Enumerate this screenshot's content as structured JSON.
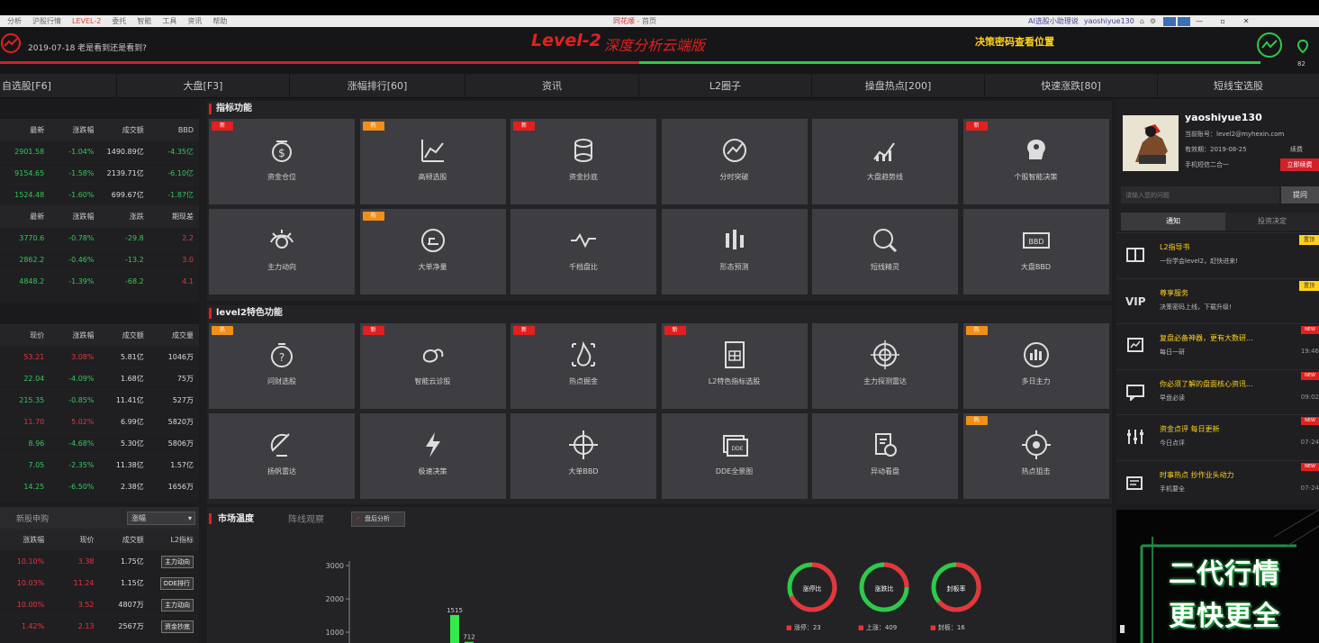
{
  "menubar": {
    "items": [
      "分析",
      "沪股行情",
      "LEVEL-2",
      "委托",
      "智能",
      "工具",
      "资讯",
      "帮助"
    ],
    "center_app": "同花顺",
    "center_rest": " - 首页",
    "right_text": "AI选股小助理说",
    "user": "yaoshiyue130"
  },
  "header": {
    "date_text": "2019-07-18 老是看到还是看到?",
    "title": "Level-2",
    "subtitle": "深度分析云端版",
    "notice": "决策密码查看位置",
    "count": "82"
  },
  "tabs": [
    {
      "label": "自选股[F6]"
    },
    {
      "label": "大盘[F3]"
    },
    {
      "label": "涨幅排行[60]"
    },
    {
      "label": "资讯"
    },
    {
      "label": "L2圈子"
    },
    {
      "label": "操盘热点[200]"
    },
    {
      "label": "快速涨跌[80]"
    },
    {
      "label": "短线宝选股"
    }
  ],
  "index_table": {
    "headers1": [
      "最新",
      "涨跌幅",
      "成交额",
      "BBD"
    ],
    "rows1": [
      [
        "2901.58",
        "-1.04%",
        "1490.89亿",
        "-4.35亿"
      ],
      [
        "9154.65",
        "-1.58%",
        "2139.71亿",
        "-6.10亿"
      ],
      [
        "1524.48",
        "-1.60%",
        "699.67亿",
        "-1.87亿"
      ]
    ],
    "headers2": [
      "最新",
      "涨跌幅",
      "涨跌",
      "期现差"
    ],
    "rows2": [
      [
        "3770.6",
        "-0.78%",
        "-29.8",
        "2.2"
      ],
      [
        "2862.2",
        "-0.46%",
        "-13.2",
        "3.0"
      ],
      [
        "4848.2",
        "-1.39%",
        "-68.2",
        "4.1"
      ]
    ]
  },
  "stock_table": {
    "headers": [
      "现价",
      "涨跌幅",
      "成交额",
      "成交量"
    ],
    "rows": [
      [
        "53.21",
        "3.08%",
        "5.81亿",
        "1046万"
      ],
      [
        "22.04",
        "-4.09%",
        "1.68亿",
        "75万"
      ],
      [
        "215.35",
        "-0.85%",
        "11.41亿",
        "527万"
      ],
      [
        "11.70",
        "5.02%",
        "6.99亿",
        "5820万"
      ],
      [
        "8.96",
        "-4.68%",
        "5.30亿",
        "5806万"
      ],
      [
        "7.05",
        "-2.35%",
        "11.38亿",
        "1.57亿"
      ],
      [
        "14.25",
        "-6.50%",
        "2.38亿",
        "1656万"
      ]
    ]
  },
  "newstock": {
    "tab1": "新股申购",
    "select": "涨幅",
    "headers": [
      "涨跌幅",
      "现价",
      "成交额",
      "L2指标"
    ],
    "rows": [
      [
        "10.10%",
        "3.38",
        "1.75亿",
        "主力动向"
      ],
      [
        "10.03%",
        "11.24",
        "1.15亿",
        "DDE排行"
      ],
      [
        "10.00%",
        "3.52",
        "4807万",
        "主力动向"
      ],
      [
        "1.42%",
        "2.13",
        "2567万",
        "资金抄底"
      ]
    ]
  },
  "features": {
    "title": "指标功能",
    "tiles": [
      {
        "label": "资金仓位",
        "badge": "新"
      },
      {
        "label": "高频选股",
        "badge": "热"
      },
      {
        "label": "资金抄底",
        "badge": "新"
      },
      {
        "label": "分时突破",
        "badge": ""
      },
      {
        "label": "大盘趋势线",
        "badge": ""
      },
      {
        "label": "个股智能决策",
        "badge": "新"
      },
      {
        "label": "主力动向",
        "badge": ""
      },
      {
        "label": "大单净量",
        "badge": "热"
      },
      {
        "label": "千档盘比",
        "badge": ""
      },
      {
        "label": "形态预测",
        "badge": ""
      },
      {
        "label": "短线精灵",
        "badge": ""
      },
      {
        "label": "大盘BBD",
        "badge": ""
      }
    ]
  },
  "level2": {
    "title": "level2特色功能",
    "tiles": [
      {
        "label": "问财选股",
        "badge": "热"
      },
      {
        "label": "智能云诊股",
        "badge": "新"
      },
      {
        "label": "热点掘金",
        "badge": "新"
      },
      {
        "label": "L2特色指标选股",
        "badge": "新"
      },
      {
        "label": "主力探测雷达",
        "badge": ""
      },
      {
        "label": "多日主力",
        "badge": "热"
      },
      {
        "label": "扬帆雷达",
        "badge": ""
      },
      {
        "label": "极速决策",
        "badge": ""
      },
      {
        "label": "大单BBD",
        "badge": ""
      },
      {
        "label": "DDE全景图",
        "badge": ""
      },
      {
        "label": "异动看盘",
        "badge": ""
      },
      {
        "label": "热点狙击",
        "badge": "热"
      }
    ]
  },
  "user": {
    "name": "yaoshiyue130",
    "line1": "当前账号：level2@myhexin.com",
    "line2": "有效期：2019-08-25",
    "renew": "续费",
    "line3": "手机短信二合一",
    "buy_button": "立即续费",
    "search_placeholder": "请输入您的问题",
    "search_button": "提问",
    "tab_notice": "通知",
    "tab_invest": "投资决定"
  },
  "notices": [
    {
      "title": "L2指导书",
      "sub": "一份学会level2，赶快进来!",
      "date": "",
      "flag": "置顶",
      "icon": "book-icon"
    },
    {
      "title": "尊享服务",
      "sub": "决策密码上线，下载升级!",
      "date": "",
      "flag": "置顶",
      "icon": "vip-icon"
    },
    {
      "title": "复盘必备神器，更有大数研...",
      "sub": "每日一研",
      "date": "19:46",
      "flag": "NEW",
      "icon": "chart-board-icon"
    },
    {
      "title": "你必须了解的盘面核心资讯...",
      "sub": "早盘必读",
      "date": "09:02",
      "flag": "NEW",
      "icon": "chat-icon"
    },
    {
      "title": "资金点评 每日更新",
      "sub": "今日点评",
      "date": "07-24",
      "flag": "NEW",
      "icon": "sliders-icon"
    },
    {
      "title": "时事热点 抄作业头动力",
      "sub": "手机要全",
      "date": "07-24",
      "flag": "NEW",
      "icon": "news-icon"
    }
  ],
  "ad": {
    "line1": "二代行情",
    "line2": "更快更全"
  },
  "market": {
    "tab1": "市场温度",
    "tab2": "阵线观察",
    "button": "盘后分析",
    "yticks": [
      "3000",
      "2000",
      "1000"
    ],
    "bar_label1": "1515",
    "bar_label2": "712",
    "ring1": "涨停比",
    "ring2": "涨跌比",
    "ring3": "封板率",
    "leg1": "涨停：23",
    "leg2": "上涨：409",
    "leg3": "封板：16"
  },
  "chart_data": {
    "type": "bar",
    "categories": [
      "",
      ""
    ],
    "values": [
      1515,
      712
    ],
    "ylim": [
      0,
      3000
    ]
  },
  "colors": {
    "accent_red": "#e2201f",
    "up": "#e8343c",
    "down": "#35c758",
    "yellow": "#ffd21a"
  }
}
